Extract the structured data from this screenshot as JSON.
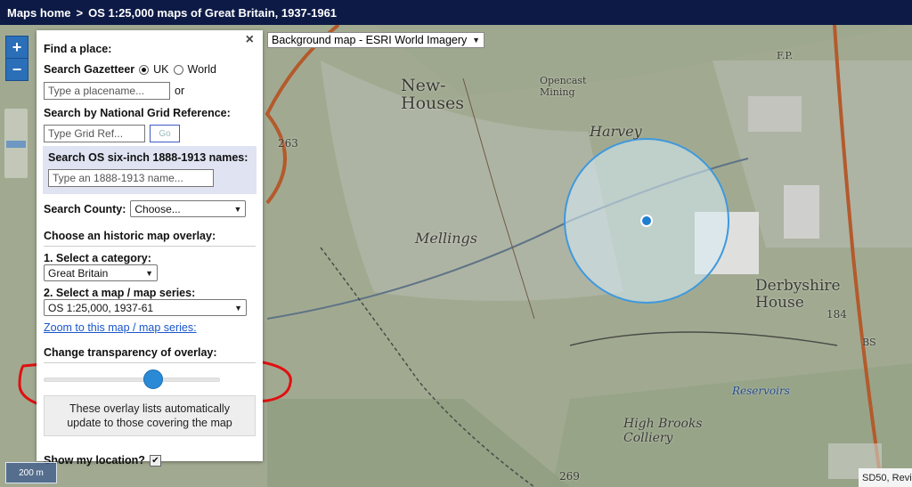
{
  "header": {
    "home": "Maps home",
    "sep": ">",
    "title": "OS 1:25,000 maps of Great Britain, 1937-1961"
  },
  "background_map": {
    "label": "Background map - ESRI World Imagery"
  },
  "zoom": {
    "in": "+",
    "out": "−"
  },
  "panel": {
    "close": "×",
    "find_place": "Find a place:",
    "gazetteer_label": "Search Gazetteer",
    "radio_uk": "UK",
    "radio_world": "World",
    "placename_placeholder": "Type a placename...",
    "or": "or",
    "grid_label": "Search by National Grid Reference:",
    "grid_placeholder": "Type Grid Ref...",
    "go": "Go",
    "os6_label": "Search OS six-inch 1888-1913 names:",
    "os6_placeholder": "Type an 1888-1913 name...",
    "county_label": "Search County:",
    "county_value": "Choose...",
    "overlay_heading": "Choose an historic map overlay:",
    "category_label": "1. Select a category:",
    "category_value": "Great Britain",
    "series_label": "2. Select a map / map series:",
    "series_value": "OS 1:25,000, 1937-61",
    "zoom_link": "Zoom to this map / map series:",
    "transparency_label": "Change transparency of overlay:",
    "transparency_value": 0.62,
    "info_text": "These overlay lists automatically update to those covering the map",
    "location_label": "Show my location?",
    "location_checked": "✔"
  },
  "map_labels": {
    "new_houses": "New-\nHouses",
    "opencast": "Opencast\nMining",
    "harvey": "Harvey",
    "mellings": "Mellings",
    "derbyshire": "Derbyshire\nHouse",
    "high_brooks": "High Brooks\nColliery",
    "reservoirs": "Reservoirs",
    "n263": "263",
    "n184": "184",
    "n269": "269",
    "bs": "BS",
    "fp": "F.P."
  },
  "scale": {
    "label": "200 m"
  },
  "corner": {
    "label": "SD50, Revi"
  },
  "colors": {
    "header_bg": "#0d1a46",
    "accent": "#2b8ad6",
    "annotation": "#e01010",
    "location": "#8fd0f5"
  }
}
